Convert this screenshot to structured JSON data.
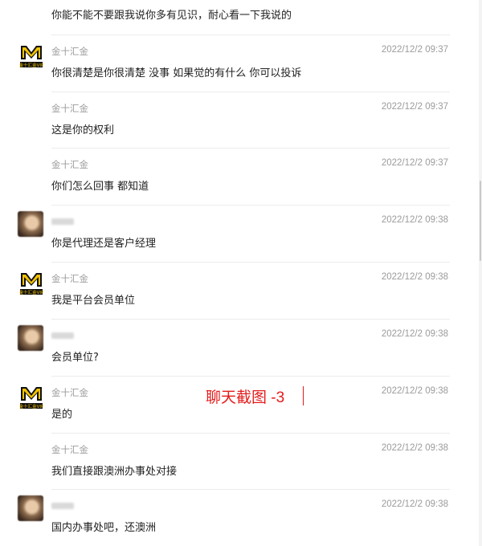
{
  "top_message": "你能不能不要跟我说你多有见识，耐心看一下我说的",
  "messages": [
    {
      "name": "金十汇金",
      "time": "2022/12/2 09:37",
      "text": "你很清楚是你很清楚  没事  如果觉的有什么  你可以投诉",
      "avatar": "gold-m-vip"
    },
    {
      "name": "金十汇金",
      "time": "2022/12/2 09:37",
      "text": "这是你的权利",
      "avatar": "none"
    },
    {
      "name": "金十汇金",
      "time": "2022/12/2 09:37",
      "text": "你们怎么回事  都知道",
      "avatar": "none"
    },
    {
      "name": "",
      "time": "2022/12/2 09:38",
      "text": "你是代理还是客户经理",
      "avatar": "blurred-photo"
    },
    {
      "name": "金十汇金",
      "time": "2022/12/2 09:38",
      "text": "我是平台会员单位",
      "avatar": "gold-m-vip"
    },
    {
      "name": "",
      "time": "2022/12/2 09:38",
      "text": "会员单位?",
      "avatar": "blurred-photo"
    },
    {
      "name": "金十汇金",
      "time": "2022/12/2 09:38",
      "text": "是的",
      "avatar": "gold-m-vip"
    },
    {
      "name": "金十汇金",
      "time": "2022/12/2 09:38",
      "text": "我们直接跟澳洲办事处对接",
      "avatar": "none"
    },
    {
      "name": "",
      "time": "2022/12/2 09:38",
      "text": "国内办事处吧，还澳洲",
      "avatar": "blurred-photo"
    }
  ],
  "annotation": "聊天截图 -3",
  "avatar_logo_text": "金十汇金VIP",
  "colors": {
    "annotation": "#e41b1b",
    "logo_gold": "#f2c200",
    "timestamp": "#9b9b9b"
  }
}
